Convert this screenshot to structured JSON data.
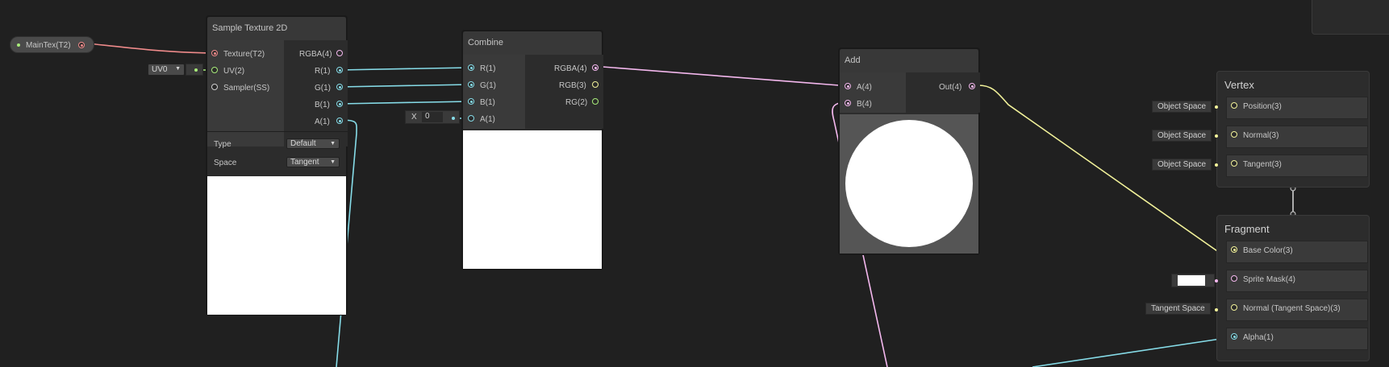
{
  "property_node": {
    "label": "MainTex(T2)"
  },
  "uv_field": {
    "value": "UV0"
  },
  "sample_texture": {
    "title": "Sample Texture 2D",
    "inputs": [
      "Texture(T2)",
      "UV(2)",
      "Sampler(SS)"
    ],
    "outputs": [
      "RGBA(4)",
      "R(1)",
      "G(1)",
      "B(1)",
      "A(1)"
    ],
    "settings": {
      "type_label": "Type",
      "type_value": "Default",
      "space_label": "Space",
      "space_value": "Tangent"
    }
  },
  "combine": {
    "title": "Combine",
    "inputs": [
      "R(1)",
      "G(1)",
      "B(1)",
      "A(1)"
    ],
    "outputs": [
      "RGBA(4)",
      "RGB(3)",
      "RG(2)"
    ],
    "a_field": {
      "axis": "X",
      "value": "0"
    }
  },
  "add": {
    "title": "Add",
    "inputs": [
      "A(4)",
      "B(4)"
    ],
    "outputs": [
      "Out(4)"
    ]
  },
  "vertex": {
    "title": "Vertex",
    "slots": [
      {
        "label": "Position(3)",
        "field": "Object Space"
      },
      {
        "label": "Normal(3)",
        "field": "Object Space"
      },
      {
        "label": "Tangent(3)",
        "field": "Object Space"
      }
    ]
  },
  "fragment": {
    "title": "Fragment",
    "slots": [
      {
        "label": "Base Color(3)",
        "field": ""
      },
      {
        "label": "Sprite Mask(4)",
        "field": ""
      },
      {
        "label": "Normal (Tangent Space)(3)",
        "field": "Tangent Space"
      },
      {
        "label": "Alpha(1)",
        "field": ""
      }
    ]
  },
  "colors": {
    "background": "#202020",
    "texture_wire": "#ee8a8a",
    "uv_wire": "#a8ec7a",
    "float_wire": "#86dce8",
    "vector4_wire": "#f4b8ee",
    "vector3_wire": "#f2f29a",
    "sprite_mask_swatch": "#ffffff"
  }
}
